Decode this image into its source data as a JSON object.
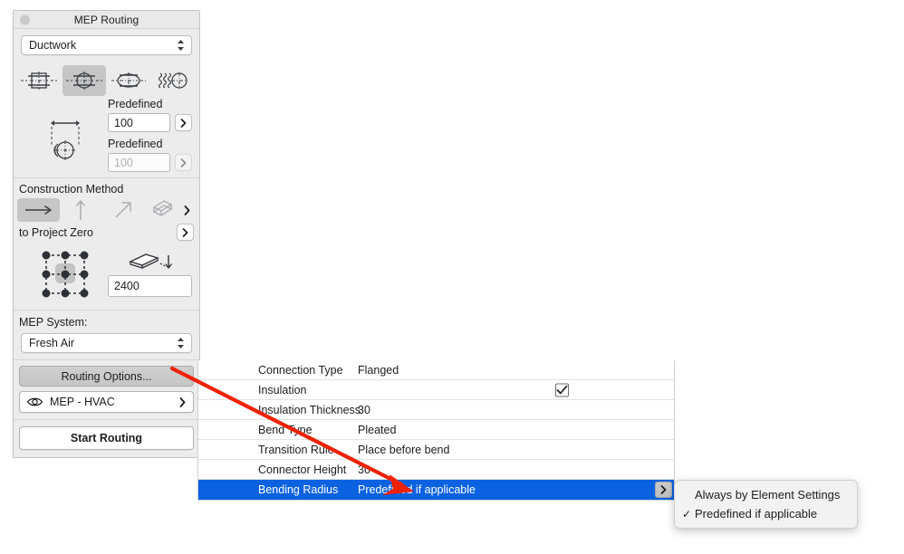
{
  "panel": {
    "title": "MEP Routing",
    "type_selector": {
      "value": "Ductwork",
      "icon": "updown-chevrons-icon"
    },
    "shape_buttons": [
      {
        "name": "rectangular-duct-icon",
        "selected": false
      },
      {
        "name": "round-duct-icon",
        "selected": true
      },
      {
        "name": "oval-duct-icon",
        "selected": false
      },
      {
        "name": "flexible-duct-icon",
        "selected": false
      }
    ],
    "width_label": "Predefined",
    "width_value": "100",
    "height_label": "Predefined",
    "height_value": "100",
    "height_placeholder": "100",
    "height_icon": "duct-height-icon",
    "construction": {
      "header": "Construction Method",
      "buttons": [
        {
          "name": "horizontal-arrow-icon",
          "selected": true
        },
        {
          "name": "vertical-arrow-icon",
          "selected": false
        },
        {
          "name": "diagonal-arrow-icon",
          "selected": false
        },
        {
          "name": "slanted-plane-icon",
          "selected": false
        }
      ],
      "more_chevron": "chevron-right-icon",
      "reference_label": "to Project Zero",
      "reference_chevron": "chevron-right-icon",
      "anchor_icon": "anchor-point-grid-icon",
      "offset_icon": "plane-offset-icon",
      "offset_value": "2400"
    },
    "mep_system": {
      "label": "MEP System:",
      "value": "Fresh Air",
      "icon": "updown-chevrons-icon"
    },
    "routing_options_button": "Routing Options...",
    "layer_row": {
      "icon": "eye-icon",
      "label": "MEP - HVAC",
      "chevron": "chevron-right-icon"
    },
    "start_button": "Start Routing"
  },
  "property_table": {
    "rows": [
      {
        "name": "Connection Type",
        "value": "Flanged",
        "type": "text",
        "selected": false
      },
      {
        "name": "Insulation",
        "value": "",
        "type": "checkbox",
        "checked": true,
        "selected": false
      },
      {
        "name": "Insulation Thickness",
        "value": "30",
        "type": "text",
        "selected": false
      },
      {
        "name": "Bend Type",
        "value": "Pleated",
        "type": "text",
        "selected": false
      },
      {
        "name": "Transition Rule",
        "value": "Place before bend",
        "type": "text",
        "selected": false
      },
      {
        "name": "Connector Height",
        "value": "30",
        "type": "text",
        "selected": false
      },
      {
        "name": "Bending Radius",
        "value": "Predefined if applicable",
        "type": "text",
        "selected": true,
        "chevron": "chevron-right-icon"
      }
    ],
    "selected_color": "#0a62e0"
  },
  "dropdown_menu": {
    "items": [
      {
        "label": "Always by Element Settings",
        "checked": false
      },
      {
        "label": "Predefined if applicable",
        "checked": true
      }
    ],
    "check_glyph": "✓"
  },
  "annotation": {
    "arrow_color": "#ee2200",
    "name": "red-pointer-arrow"
  }
}
